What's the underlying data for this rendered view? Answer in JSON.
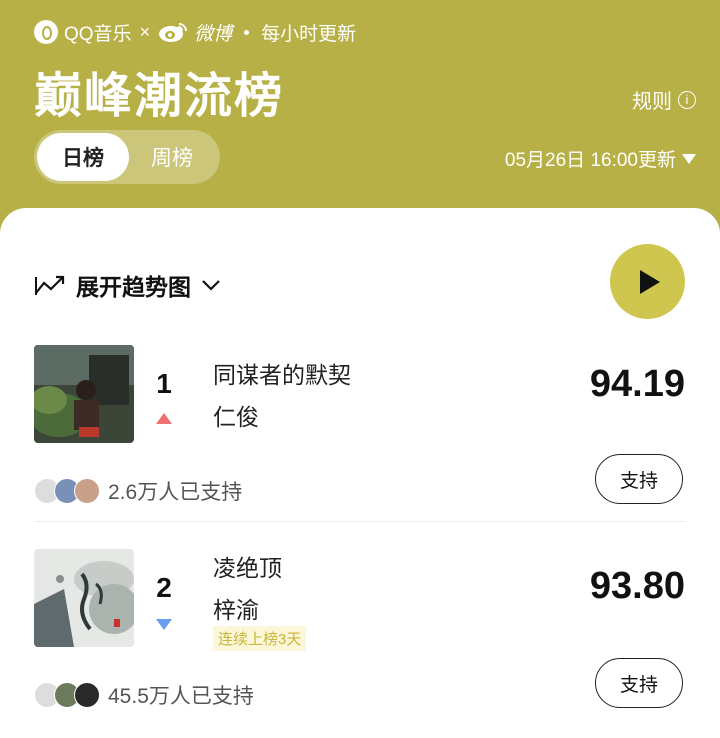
{
  "header": {
    "brand_qq": "QQ音乐",
    "brand_sep": "×",
    "brand_weibo": "微博",
    "brand_update_freq": "每小时更新",
    "title": "巅峰潮流榜",
    "rules_label": "规则",
    "rules_icon": "i",
    "tabs": [
      {
        "label": "日榜",
        "active": true
      },
      {
        "label": "周榜",
        "active": false
      }
    ],
    "update_time": "05月26日 16:00更新"
  },
  "list": {
    "trend_label": "展开趋势图",
    "songs": [
      {
        "rank": "1",
        "title": "同谋者的默契",
        "artist": "仁俊",
        "score": "94.19",
        "trend": "up",
        "support_count": "2.6万人已支持",
        "support_label": "支持",
        "badge": ""
      },
      {
        "rank": "2",
        "title": "凌绝顶",
        "artist": "梓渝",
        "score": "93.80",
        "trend": "down",
        "support_count": "45.5万人已支持",
        "support_label": "支持",
        "badge": "连续上榜3天"
      }
    ]
  },
  "colors": {
    "brand": "#b7b046",
    "play": "#cfc64f",
    "up": "#f07070",
    "down": "#6a9cf0"
  }
}
